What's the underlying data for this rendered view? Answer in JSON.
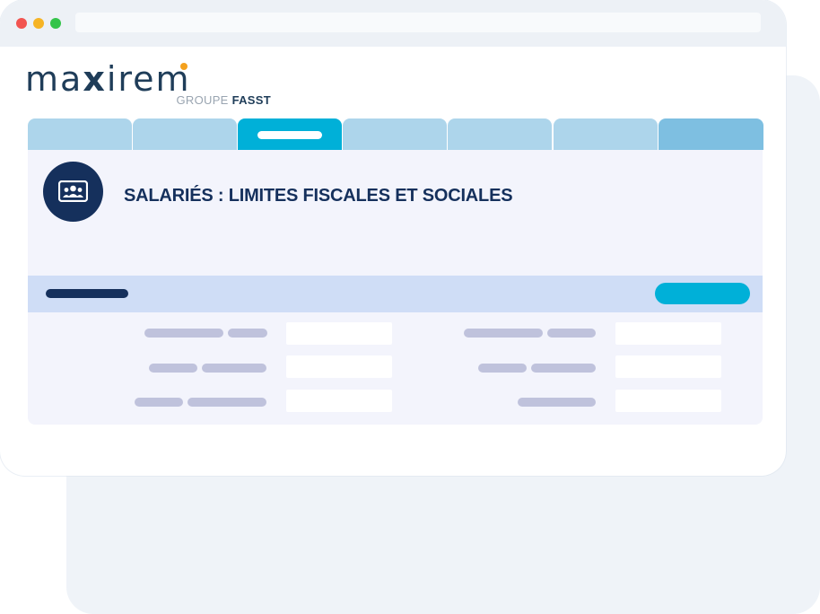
{
  "browser": {
    "window_controls": [
      "close",
      "minimize",
      "maximize"
    ],
    "address_bar": ""
  },
  "logo": {
    "word": "ma",
    "word_x": "x",
    "word_rest": "irem",
    "group_prefix": "GROUPE",
    "group_name": "FASST"
  },
  "tabs": [
    {
      "label": "",
      "active": false
    },
    {
      "label": "",
      "active": false
    },
    {
      "label": "",
      "active": true
    },
    {
      "label": "",
      "active": false
    },
    {
      "label": "",
      "active": false
    },
    {
      "label": "",
      "active": false
    },
    {
      "label": "",
      "active": false
    }
  ],
  "page": {
    "icon": "users-group-icon",
    "title": "SALARIÉS : LIMITES FISCALES ET SOCIALES"
  },
  "colors": {
    "brand_navy": "#15305c",
    "accent_cyan": "#00b0d8",
    "tab_light": "#add5eb",
    "section_bg": "#cfddf6",
    "placeholder_text": "#bfc2dc",
    "logo_dot": "#f4a11e"
  }
}
